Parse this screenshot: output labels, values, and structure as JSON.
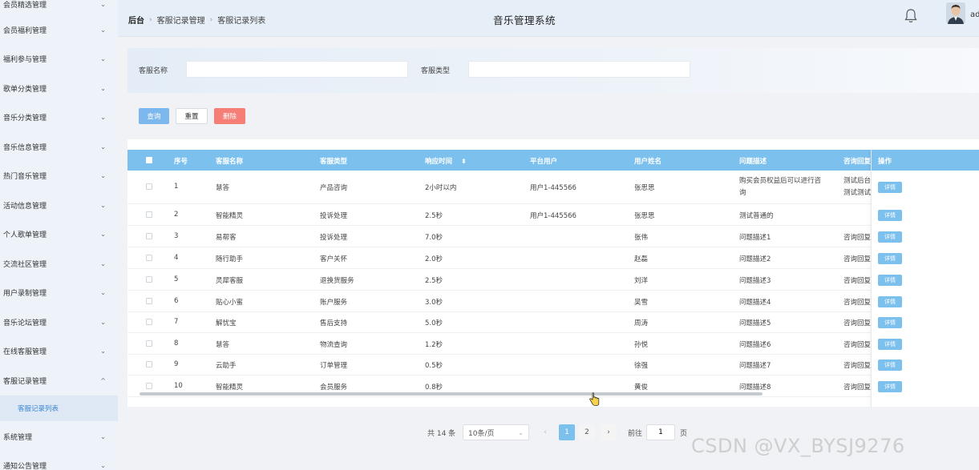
{
  "sidebar": {
    "items": [
      {
        "label": "会员精选管理",
        "chev": "⌄"
      },
      {
        "label": "会员福利管理",
        "chev": "⌄"
      },
      {
        "label": "福利参与管理",
        "chev": "⌄"
      },
      {
        "label": "歌单分类管理",
        "chev": "⌄"
      },
      {
        "label": "音乐分类管理",
        "chev": "⌄"
      },
      {
        "label": "音乐信息管理",
        "chev": "⌄"
      },
      {
        "label": "热门音乐管理",
        "chev": "⌄"
      },
      {
        "label": "活动信息管理",
        "chev": "⌄"
      },
      {
        "label": "个人歌单管理",
        "chev": "⌄"
      },
      {
        "label": "交流社区管理",
        "chev": "⌄"
      },
      {
        "label": "用户录制管理",
        "chev": "⌄"
      },
      {
        "label": "音乐论坛管理",
        "chev": "⌄"
      },
      {
        "label": "在线客服管理",
        "chev": "⌄"
      },
      {
        "label": "客服记录管理",
        "chev": "^"
      }
    ],
    "sub_item": "客服记录列表",
    "bottom_items": [
      {
        "label": "系统管理",
        "chev": "⌄"
      },
      {
        "label": "通知公告管理",
        "chev": "⌄"
      }
    ]
  },
  "header": {
    "breadcrumb": [
      "后台",
      "客服记录管理",
      "客服记录列表"
    ],
    "breadcrumb_sep": "›",
    "system_title": "音乐管理系统",
    "admin_name": "ad"
  },
  "search": {
    "name_label": "客服名称",
    "name_value": "",
    "type_label": "客服类型",
    "type_value": ""
  },
  "actions": {
    "query": "查询",
    "reset": "重置",
    "delete": "删除"
  },
  "table": {
    "columns": {
      "index": "序号",
      "name": "客服名称",
      "type": "客服类型",
      "response": "响应时间",
      "sort_icon": "⬍",
      "platform_user": "平台用户",
      "user_name": "用户姓名",
      "problem": "问题描述",
      "reply": "咨询回复",
      "ops": "操作"
    },
    "detail_label": "详情",
    "rows": [
      {
        "index": "1",
        "name": "慧答",
        "type": "产品咨询",
        "response": "2小时以内",
        "platform_user": "用户1-445566",
        "user_name": "张思思",
        "problem": "购买会员权益后可以进行咨",
        "problem2": "询",
        "reply": "测试后台",
        "reply2": "测试测试"
      },
      {
        "index": "2",
        "name": "智能精灵",
        "type": "投诉处理",
        "response": "2.5秒",
        "platform_user": "用户1-445566",
        "user_name": "张思思",
        "problem": "测试普通的",
        "problem2": "",
        "reply": "",
        "reply2": ""
      },
      {
        "index": "3",
        "name": "易帮客",
        "type": "投诉处理",
        "response": "7.0秒",
        "platform_user": "",
        "user_name": "张伟",
        "problem": "问题描述1",
        "problem2": "",
        "reply": "咨询回复",
        "reply2": ""
      },
      {
        "index": "4",
        "name": "随行助手",
        "type": "客户关怀",
        "response": "2.0秒",
        "platform_user": "",
        "user_name": "赵磊",
        "problem": "问题描述2",
        "problem2": "",
        "reply": "咨询回复",
        "reply2": ""
      },
      {
        "index": "5",
        "name": "灵犀客服",
        "type": "退换货服务",
        "response": "2.5秒",
        "platform_user": "",
        "user_name": "刘洋",
        "problem": "问题描述3",
        "problem2": "",
        "reply": "咨询回复",
        "reply2": ""
      },
      {
        "index": "6",
        "name": "贴心小蜜",
        "type": "账户服务",
        "response": "3.0秒",
        "platform_user": "",
        "user_name": "吴雪",
        "problem": "问题描述4",
        "problem2": "",
        "reply": "咨询回复",
        "reply2": ""
      },
      {
        "index": "7",
        "name": "解忧宝",
        "type": "售后支持",
        "response": "5.0秒",
        "platform_user": "",
        "user_name": "周涛",
        "problem": "问题描述5",
        "problem2": "",
        "reply": "咨询回复",
        "reply2": ""
      },
      {
        "index": "8",
        "name": "慧答",
        "type": "物流查询",
        "response": "1.2秒",
        "platform_user": "",
        "user_name": "孙悦",
        "problem": "问题描述6",
        "problem2": "",
        "reply": "咨询回复",
        "reply2": ""
      },
      {
        "index": "9",
        "name": "云助手",
        "type": "订单管理",
        "response": "0.5秒",
        "platform_user": "",
        "user_name": "徐强",
        "problem": "问题描述7",
        "problem2": "",
        "reply": "咨询回复",
        "reply2": ""
      },
      {
        "index": "10",
        "name": "智能精灵",
        "type": "会员服务",
        "response": "0.8秒",
        "platform_user": "",
        "user_name": "黄俊",
        "problem": "问题描述8",
        "problem2": "",
        "reply": "咨询回复",
        "reply2": ""
      }
    ]
  },
  "pagination": {
    "total": "共 14 条",
    "page_size": "10条/页",
    "prev": "‹",
    "next": "›",
    "pages": [
      "1",
      "2"
    ],
    "goto_label": "前往",
    "goto_value": "1",
    "page_suffix": "页"
  },
  "watermark": "CSDN @VX_BYSJ9276",
  "colors": {
    "accent": "#7cc0ee",
    "query": "#7cb7ee",
    "delete": "#f57e77",
    "sidebar": "#eef3f9"
  }
}
